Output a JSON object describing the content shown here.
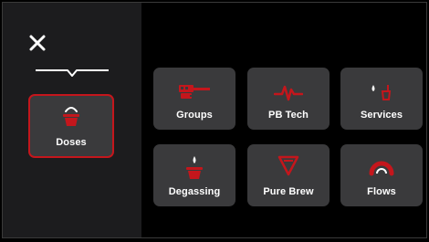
{
  "colors": {
    "accent": "#c4161c",
    "tile": "#3a3a3c",
    "sidebar": "#1c1c1e",
    "text": "#ffffff"
  },
  "sidebar": {
    "close_icon": "close-icon",
    "divider_icon": "chevron-divider-icon",
    "selected": {
      "label": "Doses",
      "icon": "dose-cup-icon"
    }
  },
  "menu": {
    "tiles": [
      {
        "label": "Groups",
        "icon": "group-head-icon"
      },
      {
        "label": "PB Tech",
        "icon": "pulse-icon"
      },
      {
        "label": "Services",
        "icon": "drops-icon"
      },
      {
        "label": "Degassing",
        "icon": "degassing-cup-icon"
      },
      {
        "label": "Pure Brew",
        "icon": "filter-cone-icon"
      },
      {
        "label": "Flows",
        "icon": "flow-gauge-icon"
      }
    ]
  }
}
